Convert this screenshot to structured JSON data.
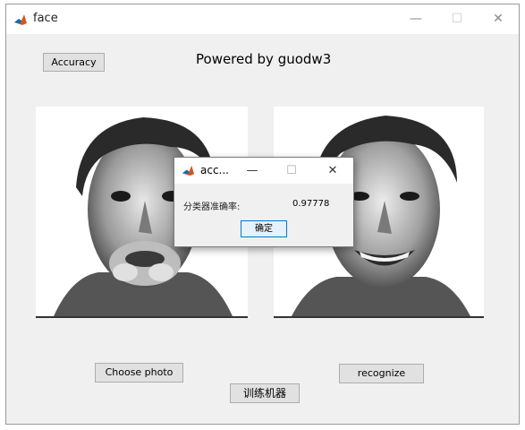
{
  "window": {
    "title": "face"
  },
  "titlebar_buttons": {
    "minimize": "—",
    "maximize": "☐",
    "close": "✕"
  },
  "accuracy_button": "Accuracy",
  "heading": "Powered by guodw3",
  "photos": {
    "left_alt": "face photo (puffed cheeks)",
    "right_alt": "face photo (smiling)"
  },
  "buttons": {
    "choose_photo": "Choose photo",
    "recognize": "recognize",
    "train": "训练机器"
  },
  "dialog": {
    "title": "acc...",
    "minimize": "—",
    "maximize": "☐",
    "close": "✕",
    "label": "分类器准确率:",
    "value": "0.97778",
    "ok": "确定"
  },
  "colors": {
    "accent": "#0078d7",
    "window_bg": "#f0f0f0",
    "button_bg": "#e1e1e1"
  }
}
